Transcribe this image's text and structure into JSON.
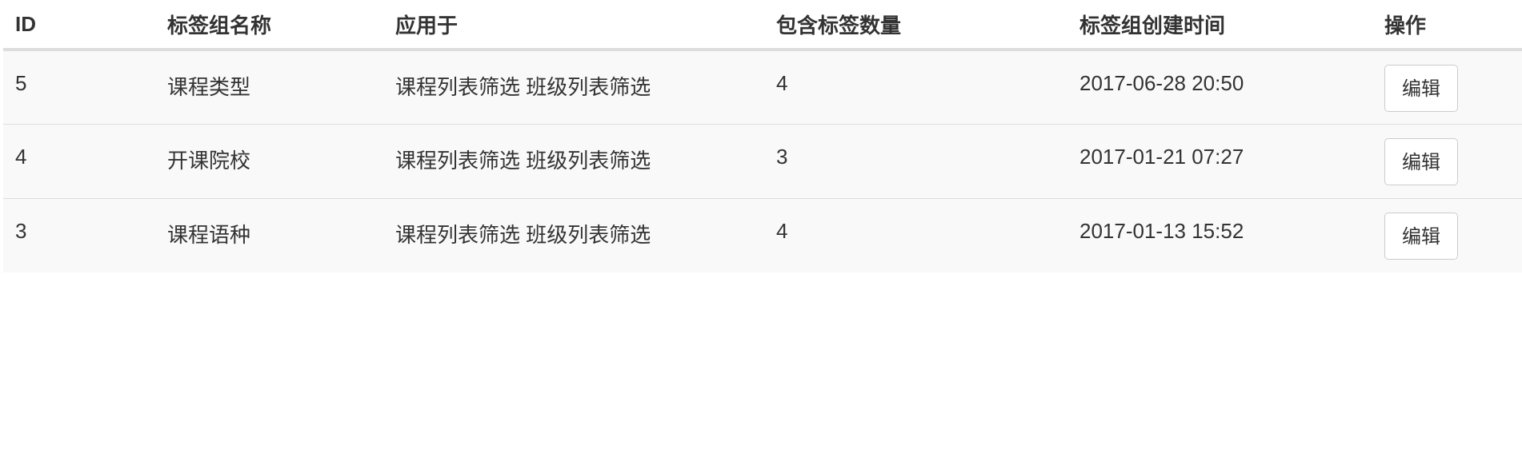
{
  "table": {
    "headers": [
      "ID",
      "标签组名称",
      "应用于",
      "包含标签数量",
      "标签组创建时间",
      "操作"
    ],
    "rows": [
      {
        "id": "5",
        "name": "课程类型",
        "applied_to": "课程列表筛选 班级列表筛选",
        "tag_count": "4",
        "created_at": "2017-06-28 20:50",
        "action_label": "编辑"
      },
      {
        "id": "4",
        "name": "开课院校",
        "applied_to": "课程列表筛选 班级列表筛选",
        "tag_count": "3",
        "created_at": "2017-01-21 07:27",
        "action_label": "编辑"
      },
      {
        "id": "3",
        "name": "课程语种",
        "applied_to": "课程列表筛选 班级列表筛选",
        "tag_count": "4",
        "created_at": "2017-01-13 15:52",
        "action_label": "编辑"
      }
    ]
  }
}
